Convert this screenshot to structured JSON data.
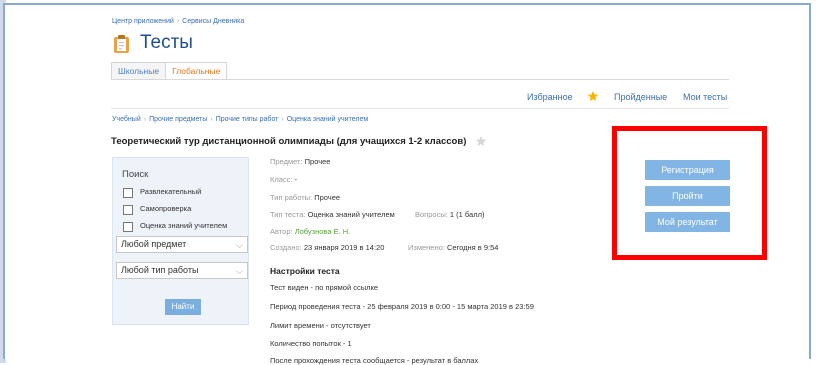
{
  "breadcrumb_top": [
    "Центр приложений",
    "Сервисы Дневника"
  ],
  "page_title": "Тесты",
  "tabs": [
    "Школьные",
    "Глобальные"
  ],
  "active_tab": 1,
  "toplinks": {
    "favorites": "Избранное",
    "passed": "Пройденные",
    "my_tests": "Мои тесты"
  },
  "breadcrumb2": [
    "Учебный",
    "Прочие предметы",
    "Прочие типы работ",
    "Оценка знаний учителем"
  ],
  "test_title": "Теоретический тур дистанционной олимпиады (для учащихся 1-2 классов)",
  "search": {
    "title": "Поиск",
    "checkboxes": [
      "Развлекательный",
      "Самопроверка",
      "Оценка знаний учителем"
    ],
    "subject_select": "Любой предмет",
    "worktype_select": "Любой тип работы",
    "find_button": "Найти"
  },
  "meta": {
    "subject_label": "Предмет:",
    "subject": "Прочее",
    "class_label": "Класс:",
    "class": "-",
    "worktype_label": "Тип работы:",
    "worktype": "Прочее",
    "testtype_label": "Тип теста:",
    "testtype": "Оценка знаний учителем",
    "questions_label": "Вопросы:",
    "questions": "1 (1 балл)",
    "author_label": "Автор:",
    "author": "Лобузнова Е. Н.",
    "created_label": "Создано:",
    "created": "23 января 2019 в 14:20",
    "modified_label": "Изменено:",
    "modified": "Сегодня в 9:54"
  },
  "settings": {
    "title": "Настройки теста",
    "lines": [
      "Тест виден - по прямой ссылке",
      "Период проведения теста - 25 февраля 2019 в 0:00 - 15 марта 2019 в 23:59",
      "Лимит времени - отсутствует",
      "Количество попыток - 1",
      "После прохождения теста сообщается - результат в баллах"
    ]
  },
  "actions": {
    "register": "Регистрация",
    "start": "Пройти",
    "my_result": "Мой результат"
  },
  "colors": {
    "link": "#3a6fb0",
    "accent_tab": "#e3781e",
    "button": "#82b5e4",
    "highlight": "#ff0000",
    "author": "#5aa03c"
  }
}
